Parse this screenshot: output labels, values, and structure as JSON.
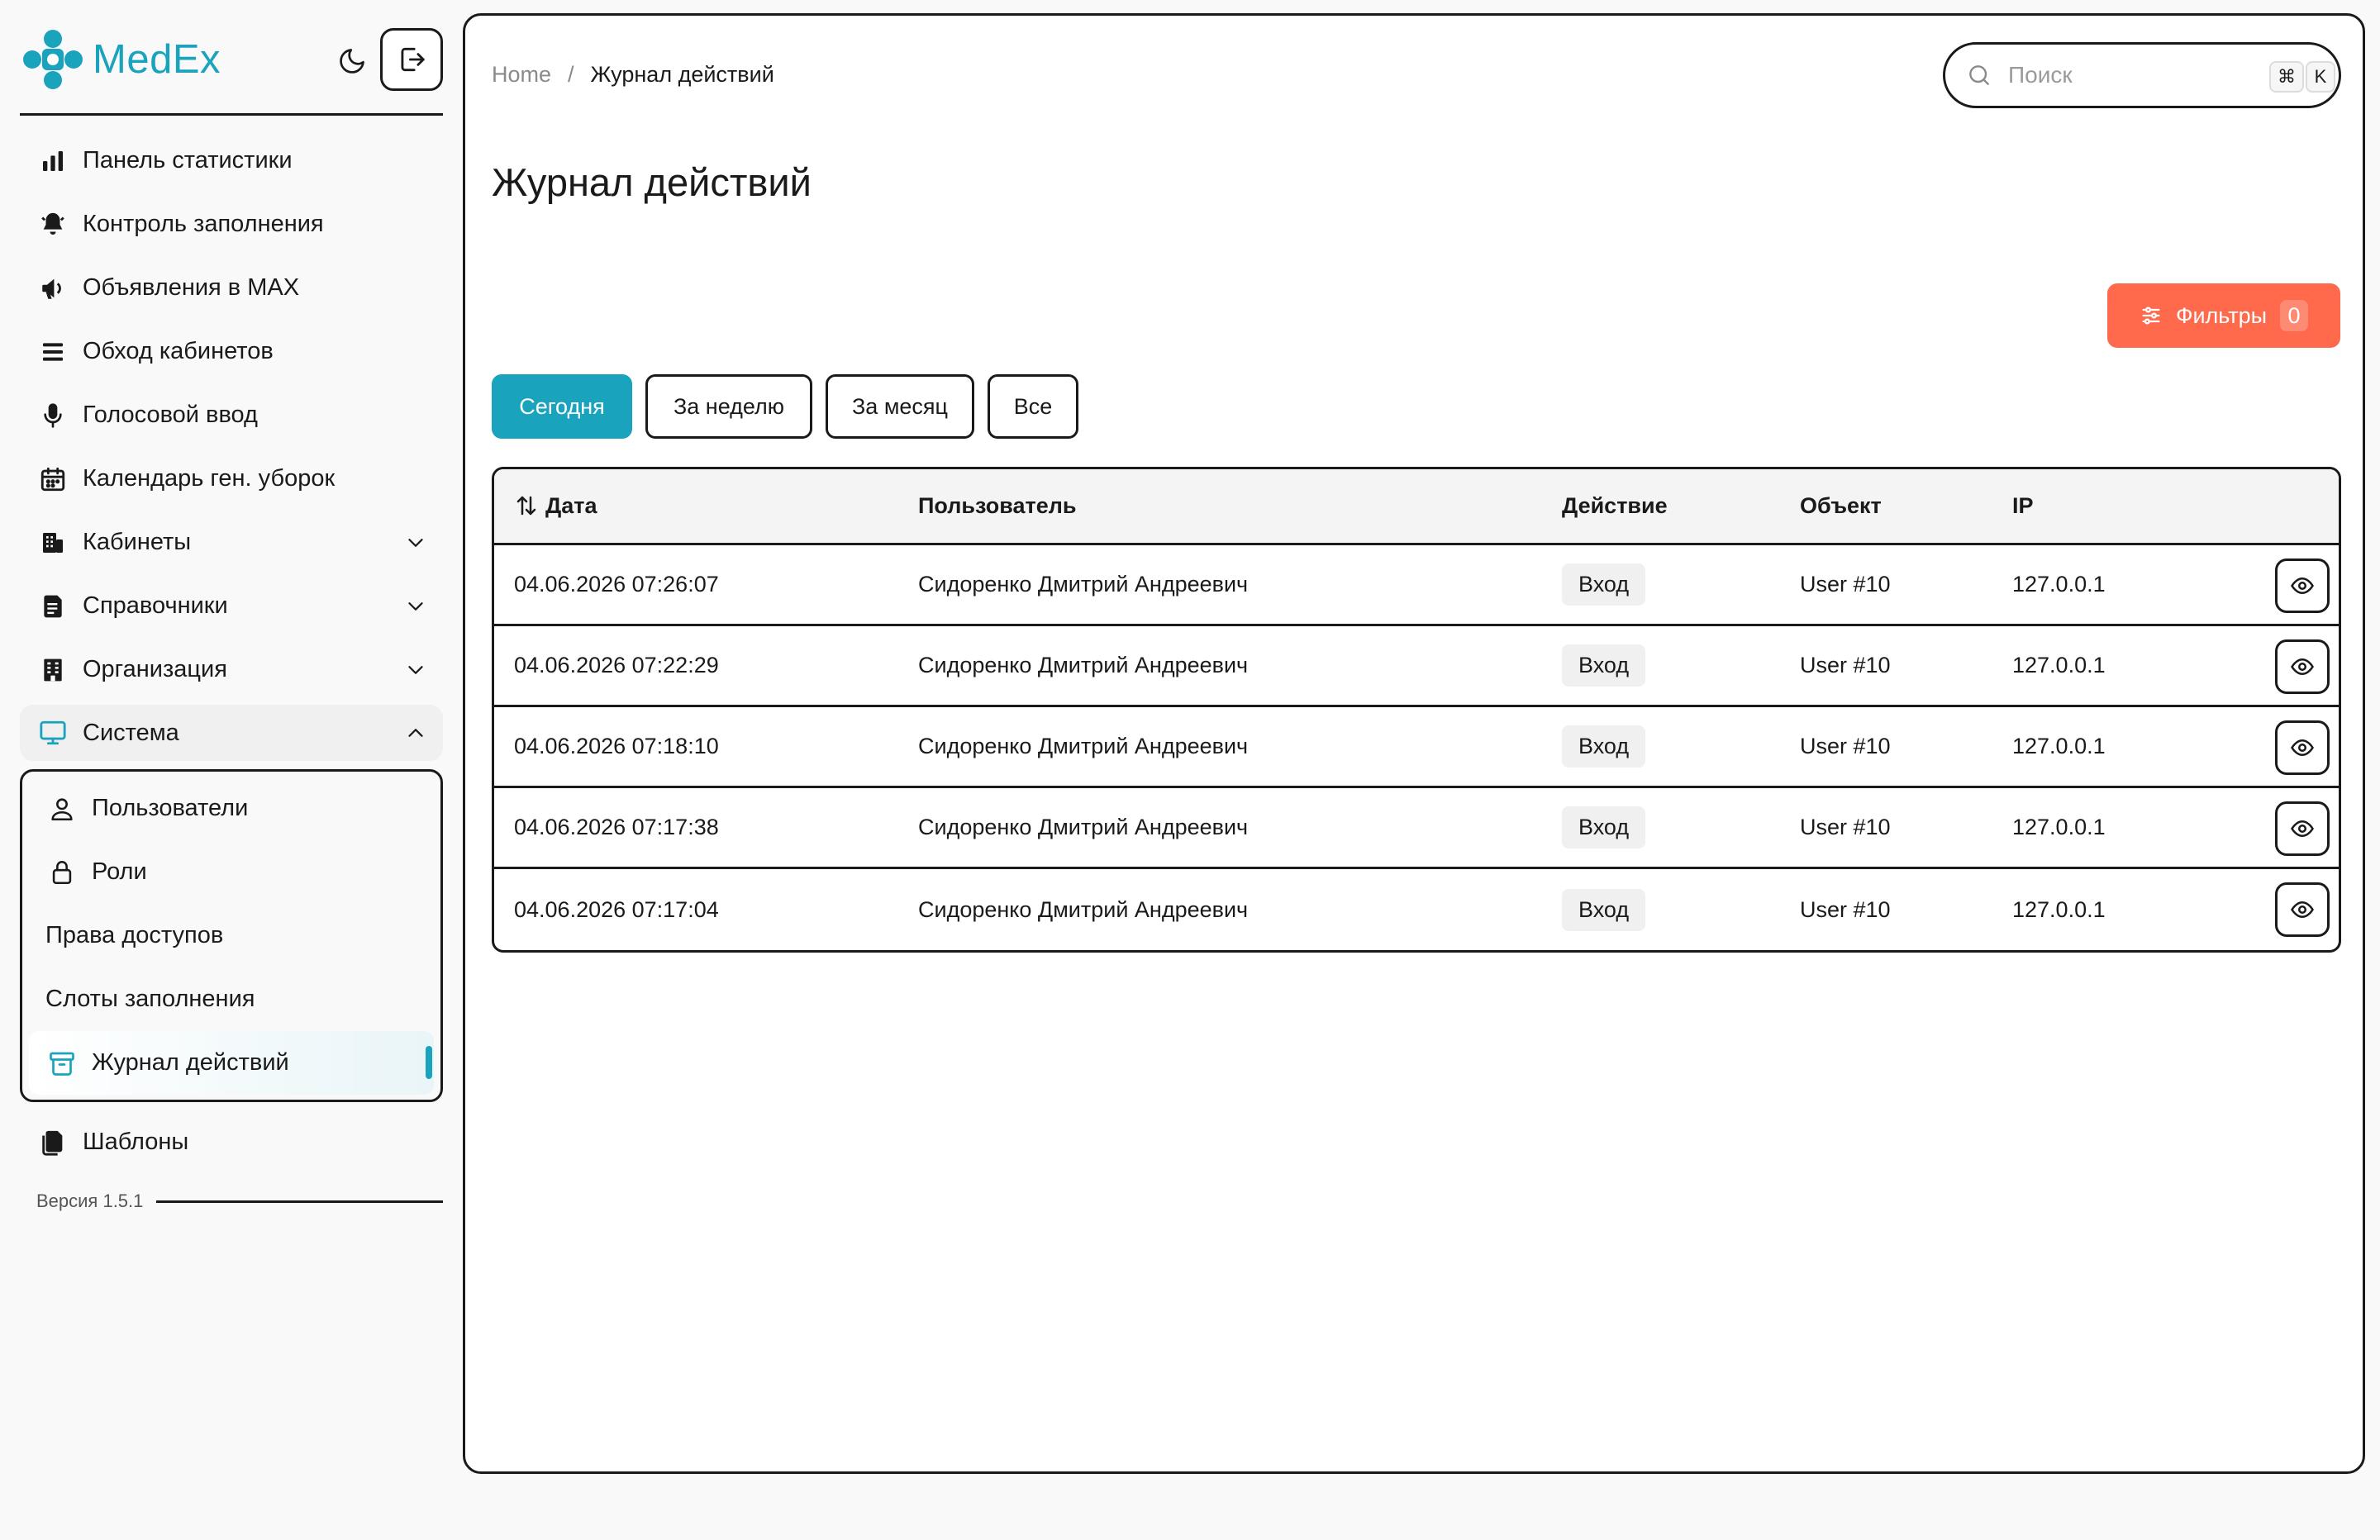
{
  "app": {
    "name": "MedEx",
    "brand_color": "#1aa3bd",
    "accent_color": "#ff6a4d"
  },
  "sidebar": {
    "items": [
      {
        "label": "Панель статистики",
        "icon": "bar-chart-icon"
      },
      {
        "label": "Контроль заполнения",
        "icon": "bell-icon"
      },
      {
        "label": "Объявления в MAX",
        "icon": "megaphone-icon"
      },
      {
        "label": "Обход кабинетов",
        "icon": "list-icon"
      },
      {
        "label": "Голосовой ввод",
        "icon": "microphone-icon"
      },
      {
        "label": "Календарь ген. уборок",
        "icon": "calendar-icon"
      },
      {
        "label": "Кабинеты",
        "icon": "building-icon",
        "expandable": true
      },
      {
        "label": "Справочники",
        "icon": "book-icon",
        "expandable": true
      },
      {
        "label": "Организация",
        "icon": "office-icon",
        "expandable": true
      },
      {
        "label": "Система",
        "icon": "monitor-icon",
        "expandable": true,
        "expanded": true
      }
    ],
    "system_sub": [
      {
        "label": "Пользователи",
        "icon": "user-icon"
      },
      {
        "label": "Роли",
        "icon": "lock-icon"
      },
      {
        "label": "Права доступов"
      },
      {
        "label": "Слоты заполнения"
      },
      {
        "label": "Журнал действий",
        "icon": "archive-icon",
        "active": true
      }
    ],
    "templates": {
      "label": "Шаблоны",
      "icon": "files-icon"
    },
    "version": "Версия 1.5.1"
  },
  "breadcrumb": {
    "home": "Home",
    "separator": "/",
    "current": "Журнал действий"
  },
  "search": {
    "placeholder": "Поиск",
    "shortcut_key1": "⌘",
    "shortcut_key2": "K"
  },
  "page": {
    "title": "Журнал действий"
  },
  "filters": {
    "label": "Фильтры",
    "count": "0"
  },
  "tabs": [
    {
      "label": "Сегодня",
      "active": true
    },
    {
      "label": "За неделю"
    },
    {
      "label": "За месяц"
    },
    {
      "label": "Все"
    }
  ],
  "table": {
    "columns": [
      "Дата",
      "Пользователь",
      "Действие",
      "Объект",
      "IP"
    ],
    "rows": [
      {
        "date": "04.06.2026 07:26:07",
        "user": "Сидоренко Дмитрий Андреевич",
        "action": "Вход",
        "object": "User #10",
        "ip": "127.0.0.1"
      },
      {
        "date": "04.06.2026 07:22:29",
        "user": "Сидоренко Дмитрий Андреевич",
        "action": "Вход",
        "object": "User #10",
        "ip": "127.0.0.1"
      },
      {
        "date": "04.06.2026 07:18:10",
        "user": "Сидоренко Дмитрий Андреевич",
        "action": "Вход",
        "object": "User #10",
        "ip": "127.0.0.1"
      },
      {
        "date": "04.06.2026 07:17:38",
        "user": "Сидоренко Дмитрий Андреевич",
        "action": "Вход",
        "object": "User #10",
        "ip": "127.0.0.1"
      },
      {
        "date": "04.06.2026 07:17:04",
        "user": "Сидоренко Дмитрий Андреевич",
        "action": "Вход",
        "object": "User #10",
        "ip": "127.0.0.1"
      }
    ]
  }
}
